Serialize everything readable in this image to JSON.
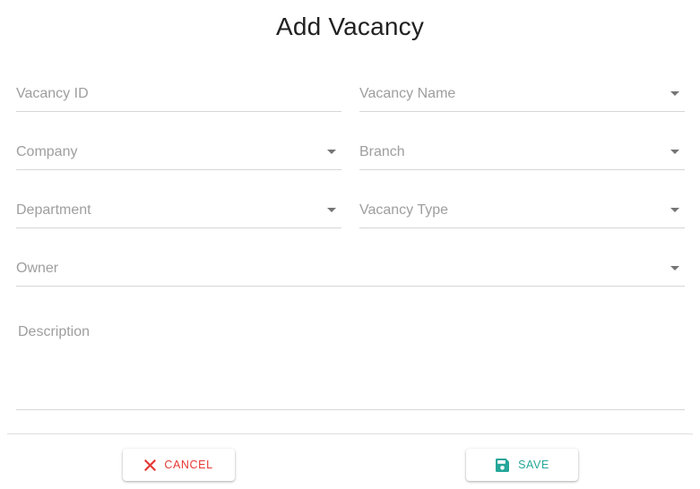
{
  "dialog": {
    "title": "Add Vacancy"
  },
  "form": {
    "vacancy_id": {
      "label": "Vacancy ID"
    },
    "vacancy_name": {
      "label": "Vacancy Name"
    },
    "company": {
      "label": "Company"
    },
    "branch": {
      "label": "Branch"
    },
    "department": {
      "label": "Department"
    },
    "vacancy_type": {
      "label": "Vacancy Type"
    },
    "owner": {
      "label": "Owner"
    },
    "description": {
      "label": "Description"
    }
  },
  "actions": {
    "cancel_label": "CANCEL",
    "save_label": "SAVE",
    "cancel_icon": "close-icon",
    "save_icon": "floppy-disk-icon"
  },
  "colors": {
    "cancel": "#e53935",
    "save": "#26a69a",
    "label": "#9e9e9e",
    "underline": "#d6d6d6"
  }
}
